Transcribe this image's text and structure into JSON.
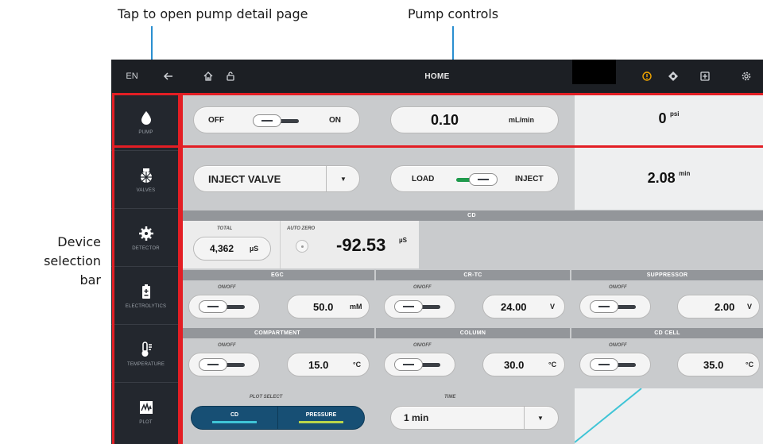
{
  "callouts": {
    "tap_pump": "Tap to open pump detail page",
    "pump_controls": "Pump controls",
    "device_selection_line1": "Device",
    "device_selection_line2": "selection",
    "device_selection_line3": "bar"
  },
  "topbar": {
    "language": "EN",
    "title": "HOME",
    "icons": [
      "back-arrow-icon",
      "home-icon",
      "lock-icon",
      "alert-icon",
      "compass-icon",
      "add-box-icon",
      "settings-icon"
    ],
    "alert_color": "#f0a500"
  },
  "sidebar": {
    "items": [
      {
        "label": "PUMP",
        "icon": "droplet-icon"
      },
      {
        "label": "VALVES",
        "icon": "valves-icon"
      },
      {
        "label": "DETECTOR",
        "icon": "detector-icon"
      },
      {
        "label": "ELECTROLYTICS",
        "icon": "electrolytics-icon"
      },
      {
        "label": "TEMPERATURE",
        "icon": "temperature-icon"
      },
      {
        "label": "PLOT",
        "icon": "plot-icon"
      }
    ]
  },
  "pump": {
    "off_label": "OFF",
    "on_label": "ON",
    "flow_value": "0.10",
    "flow_unit": "mL/min",
    "pressure_value": "0",
    "pressure_unit": "psi"
  },
  "valves": {
    "select_value": "INJECT VALVE",
    "load_label": "LOAD",
    "inject_label": "INJECT",
    "time_value": "2.08",
    "time_unit": "min"
  },
  "detector": {
    "header": "CD",
    "total_label": "TOTAL",
    "total_value": "4,362",
    "total_unit": "µS",
    "autozero_label": "AUTO ZERO",
    "reading_value": "-92.53",
    "reading_unit": "µS"
  },
  "electrolytics": {
    "egc": {
      "header": "EGC",
      "onoff": "ON/OFF",
      "value": "50.0",
      "unit": "mM"
    },
    "crtc": {
      "header": "CR-TC",
      "onoff": "ON/OFF",
      "value": "24.00",
      "unit": "V"
    },
    "suppressor": {
      "header": "SUPPRESSOR",
      "onoff": "ON/OFF",
      "value": "2.00",
      "unit": "V"
    }
  },
  "temperature": {
    "compartment": {
      "header": "COMPARTMENT",
      "onoff": "ON/OFF",
      "value": "15.0",
      "unit": "°C"
    },
    "column": {
      "header": "COLUMN",
      "onoff": "ON/OFF",
      "value": "30.0",
      "unit": "°C"
    },
    "cdcell": {
      "header": "CD CELL",
      "onoff": "ON/OFF",
      "value": "35.0",
      "unit": "°C"
    }
  },
  "plot": {
    "select_label": "PLOT SELECT",
    "options": [
      "CD",
      "PRESSURE"
    ],
    "option_colors": [
      "#3fc4d6",
      "#b8d44a"
    ],
    "time_label": "TIME",
    "time_value": "1 min",
    "trace_color": "#3fc4d6"
  }
}
